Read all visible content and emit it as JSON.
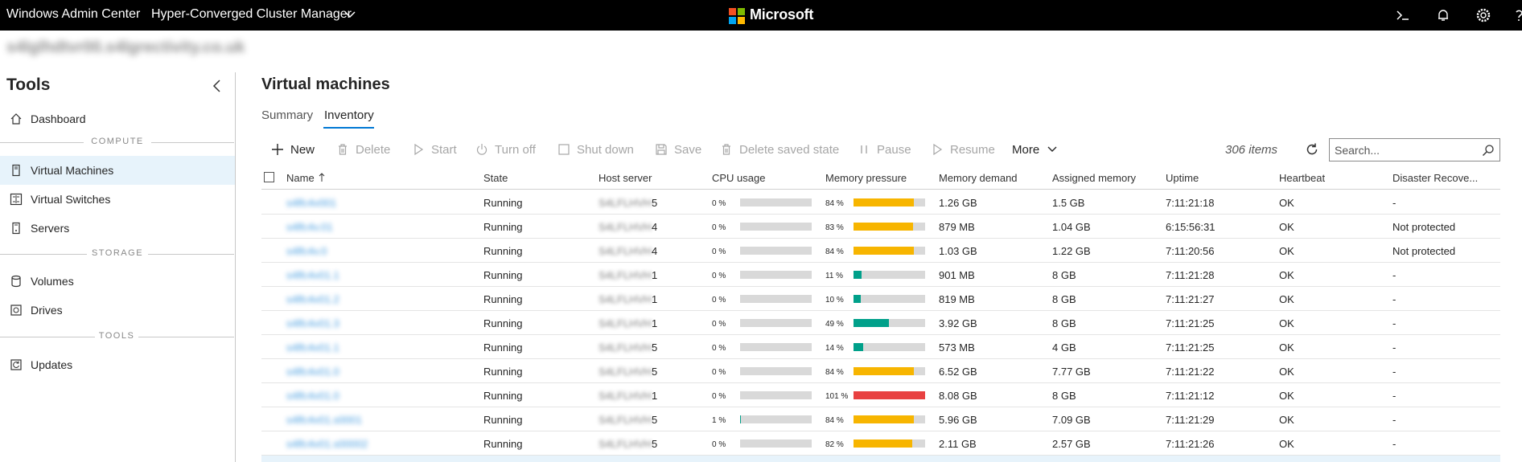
{
  "topbar": {
    "app_title": "Windows Admin Center",
    "tool_title": "Hyper-Converged Cluster Manager",
    "brand": "Microsoft",
    "icons": [
      "terminal-icon",
      "bell-icon",
      "gear-icon",
      "help-icon"
    ]
  },
  "connection_name": "s4lglhdtvr00.s4lgrectivity.co.uk",
  "sidebar": {
    "title": "Tools",
    "sections": {
      "compute": "COMPUTE",
      "storage": "STORAGE",
      "tools": "TOOLS"
    },
    "items": [
      {
        "label": "Dashboard",
        "icon": "home-icon"
      },
      {
        "label": "Virtual Machines",
        "icon": "vm-icon"
      },
      {
        "label": "Virtual Switches",
        "icon": "switch-icon"
      },
      {
        "label": "Servers",
        "icon": "server-icon"
      },
      {
        "label": "Volumes",
        "icon": "volume-icon"
      },
      {
        "label": "Drives",
        "icon": "drive-icon"
      },
      {
        "label": "Updates",
        "icon": "updates-icon"
      }
    ]
  },
  "main": {
    "title": "Virtual machines",
    "tabs": [
      {
        "label": "Summary"
      },
      {
        "label": "Inventory"
      }
    ],
    "active_tab": "Inventory"
  },
  "toolbar": {
    "new": "New",
    "delete": "Delete",
    "start": "Start",
    "turn_off": "Turn off",
    "shut_down": "Shut down",
    "save": "Save",
    "delete_saved_state": "Delete saved state",
    "pause": "Pause",
    "resume": "Resume",
    "more": "More",
    "items_count": "306 items",
    "search_placeholder": "Search..."
  },
  "table": {
    "columns": [
      "Name",
      "State",
      "Host server",
      "CPU usage",
      "Memory pressure",
      "Memory demand",
      "Assigned memory",
      "Uptime",
      "Heartbeat",
      "Disaster Recove..."
    ],
    "rows": [
      {
        "name": "s4lfc4v001",
        "state": "Running",
        "host_prefix": "S4LFLHVH",
        "host_num": "5",
        "cpu": 0,
        "cpu_label": "0 %",
        "mem": 84,
        "mem_label": "84 %",
        "demand": "1.26 GB",
        "assigned": "1.5 GB",
        "uptime": "7:11:21:18",
        "heartbeat": "OK",
        "dr": "-"
      },
      {
        "name": "s4lfc4v.01",
        "state": "Running",
        "host_prefix": "S4LFLHVH",
        "host_num": "4",
        "cpu": 0,
        "cpu_label": "0 %",
        "mem": 83,
        "mem_label": "83 %",
        "demand": "879 MB",
        "assigned": "1.04 GB",
        "uptime": "6:15:56:31",
        "heartbeat": "OK",
        "dr": "Not protected"
      },
      {
        "name": "s4lfc4v.0",
        "state": "Running",
        "host_prefix": "S4LFLHVH",
        "host_num": "4",
        "cpu": 0,
        "cpu_label": "0 %",
        "mem": 84,
        "mem_label": "84 %",
        "demand": "1.03 GB",
        "assigned": "1.22 GB",
        "uptime": "7:11:20:56",
        "heartbeat": "OK",
        "dr": "Not protected"
      },
      {
        "name": "s4lfc4v01.1",
        "state": "Running",
        "host_prefix": "S4LFLHVH",
        "host_num": "1",
        "cpu": 0,
        "cpu_label": "0 %",
        "mem": 11,
        "mem_label": "11 %",
        "demand": "901 MB",
        "assigned": "8 GB",
        "uptime": "7:11:21:28",
        "heartbeat": "OK",
        "dr": "-"
      },
      {
        "name": "s4lfc4v01.2",
        "state": "Running",
        "host_prefix": "S4LFLHVH",
        "host_num": "1",
        "cpu": 0,
        "cpu_label": "0 %",
        "mem": 10,
        "mem_label": "10 %",
        "demand": "819 MB",
        "assigned": "8 GB",
        "uptime": "7:11:21:27",
        "heartbeat": "OK",
        "dr": "-"
      },
      {
        "name": "s4lfc4v01.3",
        "state": "Running",
        "host_prefix": "S4LFLHVH",
        "host_num": "1",
        "cpu": 0,
        "cpu_label": "0 %",
        "mem": 49,
        "mem_label": "49 %",
        "demand": "3.92 GB",
        "assigned": "8 GB",
        "uptime": "7:11:21:25",
        "heartbeat": "OK",
        "dr": "-"
      },
      {
        "name": "s4lfc4v01.1",
        "state": "Running",
        "host_prefix": "S4LFLHVH",
        "host_num": "5",
        "cpu": 0,
        "cpu_label": "0 %",
        "mem": 14,
        "mem_label": "14 %",
        "demand": "573 MB",
        "assigned": "4 GB",
        "uptime": "7:11:21:25",
        "heartbeat": "OK",
        "dr": "-"
      },
      {
        "name": "s4lfc4v01.0",
        "state": "Running",
        "host_prefix": "S4LFLHVH",
        "host_num": "5",
        "cpu": 0,
        "cpu_label": "0 %",
        "mem": 84,
        "mem_label": "84 %",
        "demand": "6.52 GB",
        "assigned": "7.77 GB",
        "uptime": "7:11:21:22",
        "heartbeat": "OK",
        "dr": "-"
      },
      {
        "name": "s4lfc4v01.0",
        "state": "Running",
        "host_prefix": "S4LFLHVH",
        "host_num": "1",
        "cpu": 0,
        "cpu_label": "0 %",
        "mem": 101,
        "mem_label": "101 %",
        "demand": "8.08 GB",
        "assigned": "8 GB",
        "uptime": "7:11:21:12",
        "heartbeat": "OK",
        "dr": "-"
      },
      {
        "name": "s4lfc4v01.s0001",
        "state": "Running",
        "host_prefix": "S4LFLHVH",
        "host_num": "5",
        "cpu": 1,
        "cpu_label": "1 %",
        "mem": 84,
        "mem_label": "84 %",
        "demand": "5.96 GB",
        "assigned": "7.09 GB",
        "uptime": "7:11:21:29",
        "heartbeat": "OK",
        "dr": "-"
      },
      {
        "name": "s4lfc4v01.s00002",
        "state": "Running",
        "host_prefix": "S4LFLHVH",
        "host_num": "5",
        "cpu": 0,
        "cpu_label": "0 %",
        "mem": 82,
        "mem_label": "82 %",
        "demand": "2.11 GB",
        "assigned": "2.57 GB",
        "uptime": "7:11:21:26",
        "heartbeat": "OK",
        "dr": "-"
      }
    ]
  },
  "colors": {
    "accent": "#0078d4",
    "bar_ok": "#00a08a",
    "bar_warn": "#f7b500",
    "bar_critical": "#e84141",
    "bar_track": "#d9d9d9"
  }
}
